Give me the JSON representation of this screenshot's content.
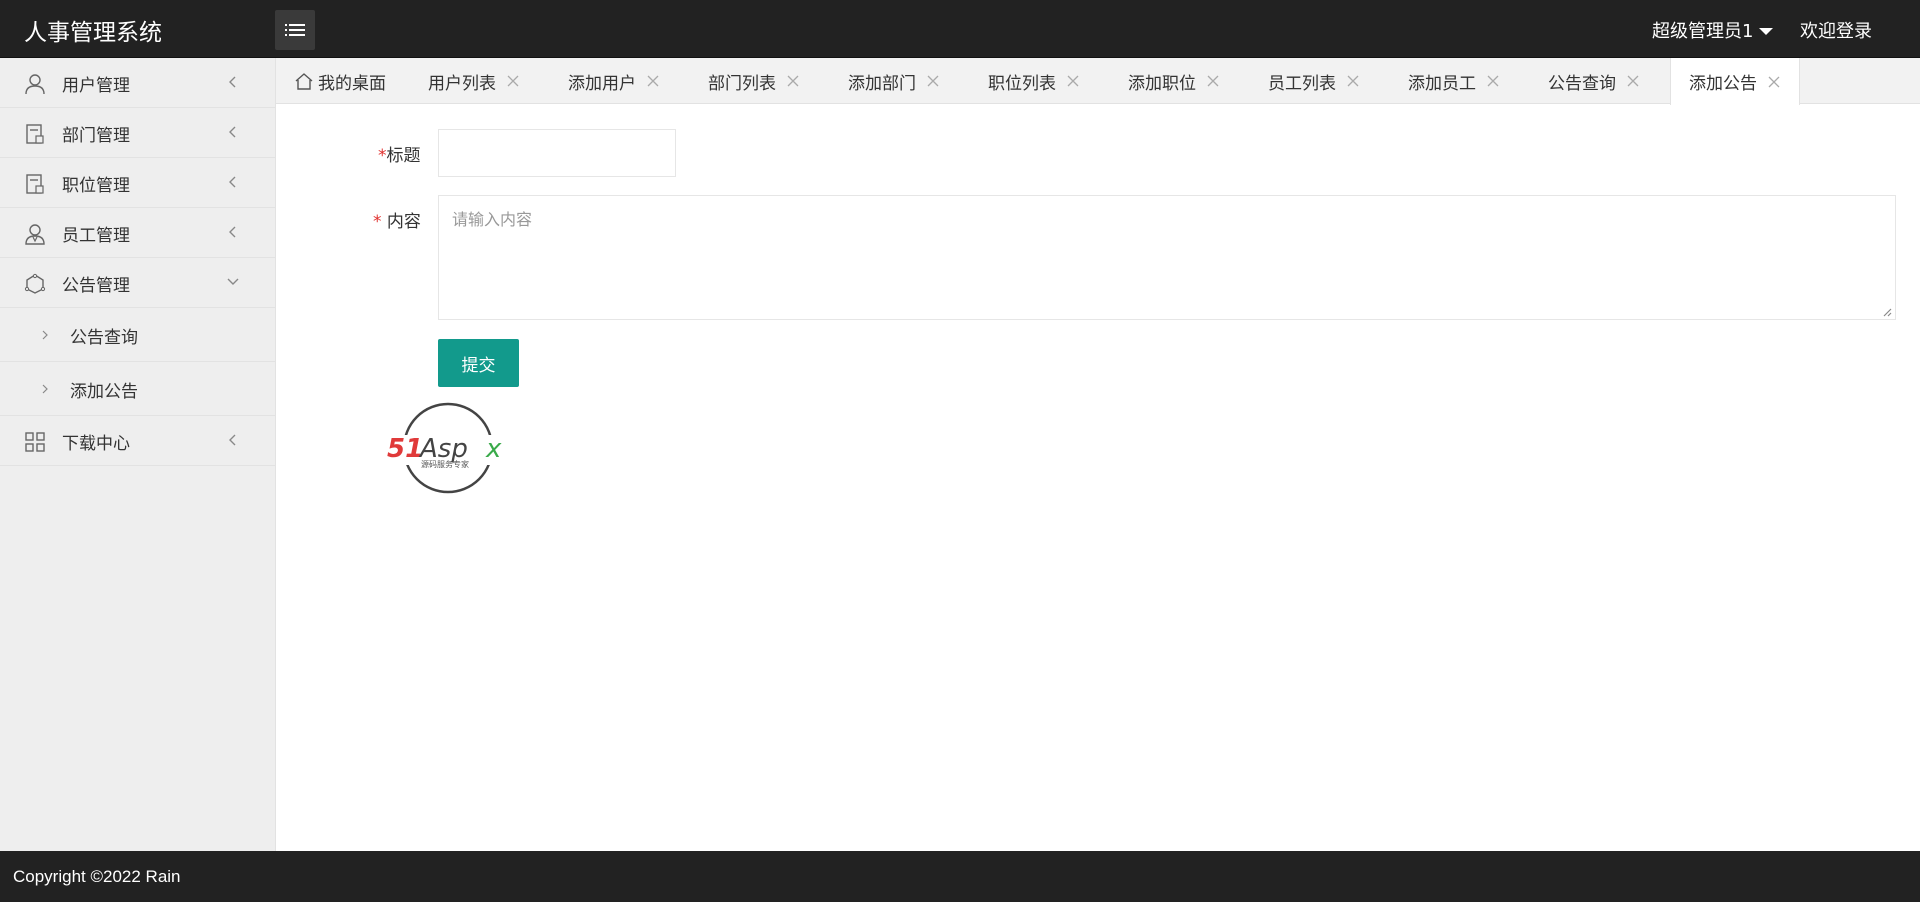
{
  "app": {
    "title": "人事管理系统",
    "user_name": "超级管理员1",
    "welcome": "欢迎登录"
  },
  "sidebar": {
    "items": [
      {
        "label": "用户管理",
        "icon": "user-icon"
      },
      {
        "label": "部门管理",
        "icon": "department-icon"
      },
      {
        "label": "职位管理",
        "icon": "position-icon"
      },
      {
        "label": "员工管理",
        "icon": "employee-icon"
      },
      {
        "label": "公告管理",
        "icon": "notice-icon",
        "expanded": true
      },
      {
        "label": "下载中心",
        "icon": "grid-icon"
      }
    ],
    "notice_subitems": [
      {
        "label": "公告查询"
      },
      {
        "label": "添加公告"
      }
    ]
  },
  "tabs": [
    {
      "label": "我的桌面",
      "home": true
    },
    {
      "label": "用户列表"
    },
    {
      "label": "添加用户"
    },
    {
      "label": "部门列表"
    },
    {
      "label": "添加部门"
    },
    {
      "label": "职位列表"
    },
    {
      "label": "添加职位"
    },
    {
      "label": "员工列表"
    },
    {
      "label": "添加员工"
    },
    {
      "label": "公告查询"
    },
    {
      "label": "添加公告",
      "active": true
    }
  ],
  "form": {
    "title_label": "标题",
    "content_label": "内容",
    "required_mark": "*",
    "title_value": "",
    "content_placeholder": "请输入内容",
    "submit_label": "提交"
  },
  "logo": {
    "brand": "51Aspx",
    "tagline": "源码服务专家"
  },
  "footer": {
    "copyright": "Copyright ©2022 Rain"
  },
  "colors": {
    "header_bg": "#222222",
    "sidebar_bg": "#eeeeee",
    "accent": "#129a8c",
    "required": "#e0312f"
  }
}
